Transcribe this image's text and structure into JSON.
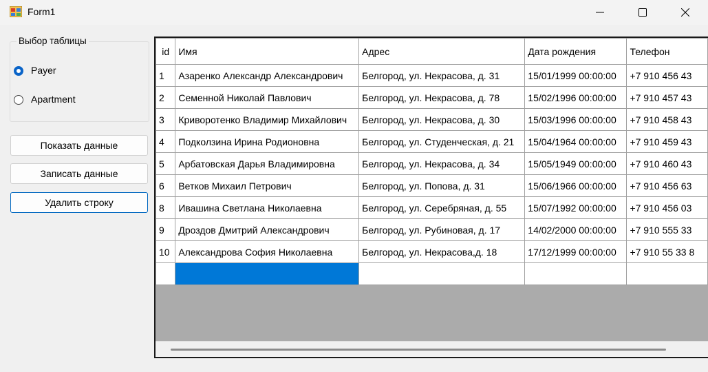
{
  "window": {
    "title": "Form1"
  },
  "group": {
    "legend": "Выбор таблицы",
    "options": [
      {
        "label": "Payer",
        "checked": true
      },
      {
        "label": "Apartment",
        "checked": false
      }
    ]
  },
  "buttons": {
    "show": "Показать данные",
    "write": "Записать данные",
    "delete": "Удалить строку"
  },
  "grid": {
    "columns": [
      "id",
      "Имя",
      "Адрес",
      "Дата рождения",
      "Телефон"
    ],
    "rows": [
      [
        "1",
        "Азаренко Александр Александрович",
        "Белгород, ул. Некрасова, д. 31",
        "15/01/1999 00:00:00",
        "+7 910 456 43"
      ],
      [
        "2",
        "Семенной Николай Павлович",
        "Белгород, ул. Некрасова, д. 78",
        "15/02/1996 00:00:00",
        "+7 910 457 43"
      ],
      [
        "3",
        "Криворотенко Владимир Михайлович",
        "Белгород, ул. Некрасова, д. 30",
        "15/03/1996 00:00:00",
        "+7 910 458 43"
      ],
      [
        "4",
        "Подколзина Ирина Родионовна",
        "Белгород, ул. Студенческая, д. 21",
        "15/04/1964 00:00:00",
        "+7 910 459 43"
      ],
      [
        "5",
        "Арбатовская Дарья Владимировна",
        "Белгород, ул. Некрасова, д. 34",
        "15/05/1949 00:00:00",
        "+7 910 460 43"
      ],
      [
        "6",
        "Ветков Михаил Петрович",
        "Белгород, ул. Попова, д. 31",
        "15/06/1966 00:00:00",
        "+7 910 456 63"
      ],
      [
        "8",
        "Ивашина Светлана Николаевна",
        "Белгород, ул. Серебряная, д. 55",
        "15/07/1992 00:00:00",
        "+7 910 456 03"
      ],
      [
        "9",
        "Дроздов Дмитрий Александрович",
        "Белгород, ул. Рубиновая, д. 17",
        "14/02/2000 00:00:00",
        "+7 910 555 33"
      ],
      [
        "10",
        "Александрова София Николаевна",
        "Белгород, ул. Некрасова,д. 18",
        "17/12/1999 00:00:00",
        "+7 910 55 33 8"
      ],
      [
        "",
        "",
        "",
        "",
        ""
      ]
    ]
  },
  "colors": {
    "accent": "#0078d7",
    "selection": "#0078d7"
  },
  "icons": {
    "app": "form-app-icon",
    "minimize": "minimize-icon",
    "maximize": "maximize-icon",
    "close": "close-icon"
  }
}
